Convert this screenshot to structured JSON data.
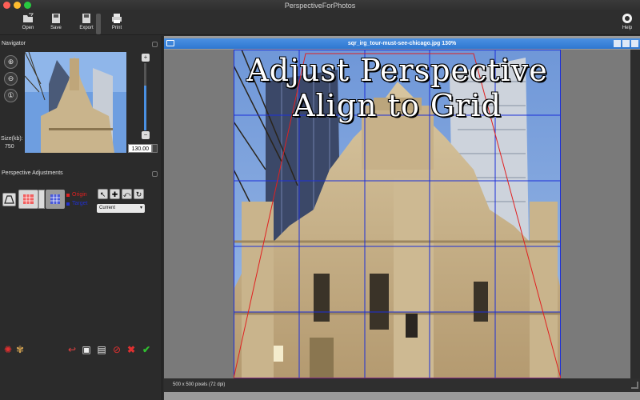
{
  "app": {
    "title": "PerspectiveForPhotos"
  },
  "toolbar": {
    "open_label": "Open",
    "save_label": "Save",
    "export_label": "Export",
    "print_label": "Print",
    "help_label": "Help"
  },
  "navigator": {
    "title": "Navigator",
    "size_label": "Size(kb):",
    "size_value": "750",
    "zoom_value": "130.00"
  },
  "perspective": {
    "title": "Perspective Adjustments",
    "origin_label": "Origin",
    "target_label": "Target",
    "mode_select": "Current"
  },
  "document": {
    "title": "sqr_irg_tour-must-see-chicago.jpg 130%",
    "overlay_line1": "Adjust Perspective",
    "overlay_line2": "Align to Grid",
    "status": "500 x 500 pixels (72 dpi)"
  },
  "colors": {
    "accent_blue": "#2f77d0",
    "grid_blue": "#1c2fd8",
    "origin_red": "#e02020",
    "target_blue": "#2030d0",
    "panel_bg": "#2b2b2b"
  }
}
